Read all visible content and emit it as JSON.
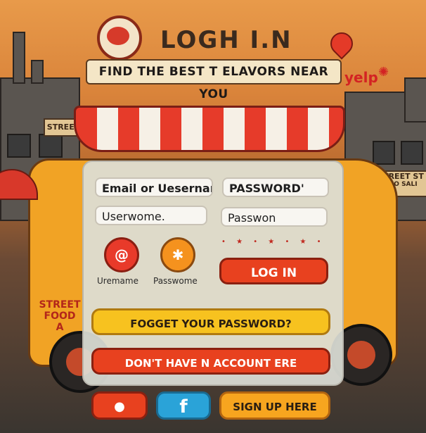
{
  "header": {
    "title": "LOGH I.N",
    "tagline": "FIND  THE BEST T ELAVORS NEAR YOU",
    "yelp_text": "yelp",
    "yelp_burst": "✺"
  },
  "scene": {
    "sign_street_left": "STREET",
    "sign_street_right": "STREET ST",
    "sign_street_right2": "PUO SALI",
    "truck_text": "STREET FOOD",
    "truck_text_sub": "A"
  },
  "form": {
    "email_label": "Email  or Uesername",
    "password_label": "PASSWORD'",
    "username_value": "Userwome.",
    "password_value": "Passwon",
    "icon_username_caption": "Uremame",
    "icon_password_caption": "Passwome",
    "login_button": "LOG IN",
    "forgot_button": "FOGGET YOUR PASSWORD?",
    "no_account_button": "DON'T HAVE N ACCOUNT ERE",
    "signup_button": "SIGN UP HERE",
    "facebook_glyph": "f",
    "youtube_glyph": "●",
    "dots": "• ★ • ★ • ★ •"
  },
  "colors": {
    "primary_red": "#e8411f",
    "accent_yellow": "#f7c21f",
    "accent_orange": "#f7a51f",
    "facebook_blue": "#2aa3d8"
  }
}
